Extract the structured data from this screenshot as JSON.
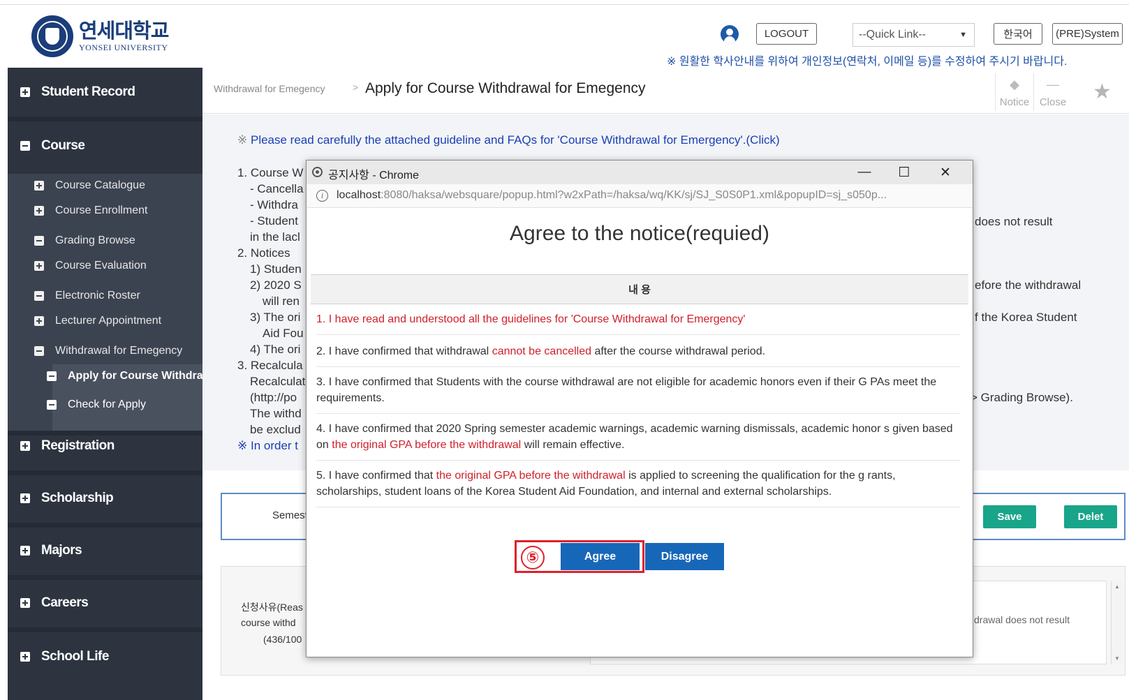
{
  "header": {
    "logo_korean": "연세대학교",
    "logo_english": "YONSEI UNIVERSITY",
    "logout_label": "LOGOUT",
    "quick_link": "--Quick Link--",
    "lang_label": "한국어",
    "system_label": "(PRE)System",
    "notice": "※ 원활한 학사안내를 위하여 개인정보(연락처, 이메일 등)를 수정하여 주시기 바랍니다."
  },
  "sidebar": {
    "student_record": "Student Record",
    "course": "Course",
    "course_subs": [
      "Course Catalogue",
      "Course Enrollment",
      "Grading Browse",
      "Course Evaluation",
      "Electronic Roster",
      "Lecturer Appointment",
      "Withdrawal for Emegency"
    ],
    "withdrawal_subs": [
      "Apply for Course Withdrawal",
      "Check for Apply"
    ],
    "registration": "Registration",
    "scholarship": "Scholarship",
    "majors": "Majors",
    "careers": "Careers",
    "school_life": "School Life"
  },
  "breadcrumb": {
    "parent": "Withdrawal for Emegency",
    "separator": ">",
    "title": "Apply for Course Withdrawal for Emegency"
  },
  "tools": {
    "notice": "Notice",
    "close": "Close"
  },
  "page": {
    "guide_mark": "※",
    "guide": "Please read carefully the attached guideline and FAQs for 'Course Withdrawal for Emergency'.(Click)",
    "lines_left": [
      "1. Course W",
      "- Cancella",
      "- Withdra",
      "- Student",
      "in the lacl",
      "2. Notices",
      "1) Studen",
      "2) 2020 S",
      "will ren",
      "3) The ori",
      "Aid Fou",
      "4) The ori",
      "3. Recalcula",
      "Recalculat",
      "(http://po",
      "The withd",
      "be exclud"
    ],
    "in_order": "※ In order t",
    "right_1": "does not result",
    "right_2": "efore the withdrawal",
    "right_3": "f the Korea Student",
    "right_4": "> Grading Browse).",
    "semester_label": "Semest",
    "save_label": "Save",
    "delete_label": "Delet",
    "reason_line1": "신청사유(Reas",
    "reason_line2": "course withd",
    "reason_line3": "(436/100",
    "reason_value": "drawal does not result"
  },
  "popup": {
    "window_title": "공지사항 - Chrome",
    "minimize": "—",
    "maximize": "☐",
    "close": "✕",
    "url_host": "localhost",
    "url_rest": ":8080/haksa/websquare/popup.html?w2xPath=/haksa/wq/KK/sj/SJ_S0S0P1.xml&popupID=sj_s050p...",
    "heading": "Agree to the notice(requied)",
    "column_header": "내 용",
    "item1": "1. I have read and understood all the guidelines for 'Course Withdrawal for Emergency'",
    "item2_a": "2. I have confirmed that withdrawal ",
    "item2_red": "cannot be cancelled",
    "item2_b": " after the course withdrawal period.",
    "item3": "3. I have confirmed that Students with the course withdrawal are not eligible for academic honors even if their G PAs meet the requirements.",
    "item4_a": "4. I have confirmed that 2020 Spring semester academic warnings, academic warning dismissals, academic honor s given based on ",
    "item4_red": "the original GPA before the withdrawal",
    "item4_b": " will remain effective.",
    "item5_a": "5. I have confirmed that ",
    "item5_red": "the original GPA before the withdrawal",
    "item5_b": " is applied to screening the qualification for the g rants, scholarships, student loans of the Korea Student Aid Foundation, and internal and external scholarships.",
    "step_badge": "⑤",
    "agree_label": "Agree",
    "disagree_label": "Disagree"
  },
  "colors": {
    "sidebar": "#2d3440",
    "accent_blue": "#1767b8",
    "save_green": "#19a58a",
    "highlight_red": "#e0202a"
  }
}
